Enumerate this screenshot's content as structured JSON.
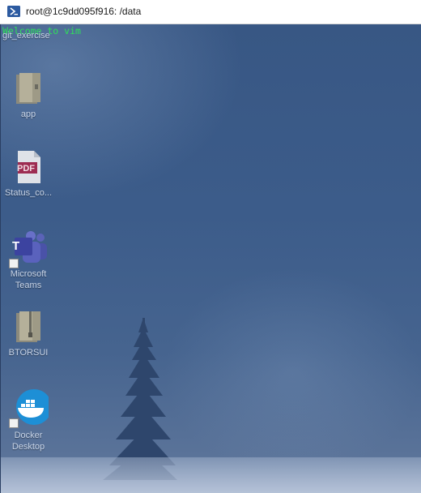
{
  "window": {
    "title": "root@1c9dd095f916: /data",
    "icon": "powershell-icon"
  },
  "terminal": {
    "welcome_text": "Welcome to vim"
  },
  "desktop": {
    "icons": [
      {
        "label": "git_exercise",
        "icon": "folder-icon"
      },
      {
        "label": "app",
        "icon": "folder-icon"
      },
      {
        "label": "Status_co...",
        "icon": "pdf-file-icon"
      },
      {
        "label": "Microsoft Teams",
        "icon": "microsoft-teams-icon"
      },
      {
        "label": "BTORSUI",
        "icon": "zip-folder-icon"
      },
      {
        "label": "Docker Desktop",
        "icon": "docker-icon"
      }
    ],
    "pdf_badge": "PDF",
    "teams_letter": "T"
  },
  "colors": {
    "terminal_text": "#2fe05a",
    "background": "#3c5c8a"
  }
}
